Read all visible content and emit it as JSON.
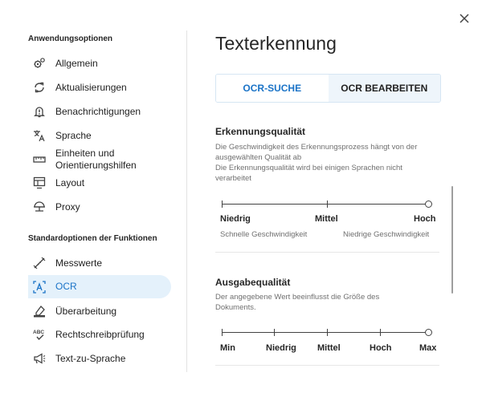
{
  "sidebar": {
    "section1_title": "Anwendungsoptionen",
    "section1_items": [
      {
        "label": "Allgemein",
        "icon": "gears-icon"
      },
      {
        "label": "Aktualisierungen",
        "icon": "refresh-icon"
      },
      {
        "label": "Benachrichtigungen",
        "icon": "bell-alert-icon"
      },
      {
        "label": "Sprache",
        "icon": "translate-icon"
      },
      {
        "label": "Einheiten und Orientierungshilfen",
        "icon": "ruler-icon"
      },
      {
        "label": "Layout",
        "icon": "layout-icon"
      },
      {
        "label": "Proxy",
        "icon": "proxy-icon"
      }
    ],
    "section2_title": "Standardoptionen der Funktionen",
    "section2_items": [
      {
        "label": "Messwerte",
        "icon": "measure-icon"
      },
      {
        "label": "OCR",
        "icon": "ocr-icon"
      },
      {
        "label": "Überarbeitung",
        "icon": "eraser-icon"
      },
      {
        "label": "Rechtschreibprüfung",
        "icon": "spellcheck-icon"
      },
      {
        "label": "Text-zu-Sprache",
        "icon": "megaphone-icon"
      }
    ],
    "active_item": "OCR"
  },
  "main": {
    "title": "Texterkennung",
    "tabs": [
      {
        "label": "OCR-SUCHE",
        "active": true
      },
      {
        "label": "OCR BEARBEITEN",
        "active": false
      }
    ],
    "recognition": {
      "heading": "Erkennungsqualität",
      "desc1": "Die Geschwindigkeit des Erkennungsprozess hängt von der ausgewählten Qualität ab",
      "desc2": "Die Erkennungsqualität wird bei einigen Sprachen nicht verarbeitet",
      "levels": [
        "Niedrig",
        "Mittel",
        "Hoch"
      ],
      "selected_index": 2,
      "sub_left": "Schnelle Geschwindigkeit",
      "sub_right": "Niedrige Geschwindigkeit"
    },
    "output": {
      "heading": "Ausgabequalität",
      "desc": "Der angegebene Wert beeinflusst die Größe des Dokuments.",
      "levels": [
        "Min",
        "Niedrig",
        "Mittel",
        "Hoch",
        "Max"
      ],
      "selected_index": 4
    }
  },
  "colors": {
    "accent": "#1a73c7",
    "active_bg": "#e4f1fb",
    "tab_inactive_bg": "#eef5fb"
  }
}
